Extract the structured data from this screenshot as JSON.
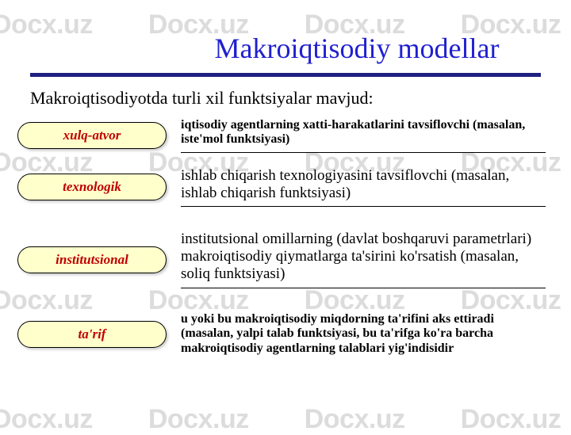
{
  "watermark": "Docx.uz",
  "title": "Makroiqtisodiy modellar",
  "intro": "Makroiqtisodiyotda turli xil funktsiyalar mavjud:",
  "rows": [
    {
      "label": "xulq-atvor",
      "desc": "iqtisodiy agentlarning xatti-harakatlarini tavsiflovchi (masalan, iste'mol funktsiyasi)",
      "styleClass": "small",
      "rule": true
    },
    {
      "label": "texnologik",
      "desc": "ishlab chiqarish texnologiyasini tavsiflovchi (masalan, ishlab chiqarish funktsiyasi)",
      "styleClass": "big",
      "rule": true
    },
    {
      "label": "institutsional",
      "desc": "institutsional omillarning (davlat boshqaruvi parametrlari) makroiqtisodiy qiymatlarga ta'sirini ko'rsatish (masalan, soliq funktsiyasi)",
      "styleClass": "big",
      "rule": true
    },
    {
      "label": "ta'rif",
      "desc": "u yoki bu makroiqtisodiy miqdorning ta'rifini aks ettiradi (masalan, yalpi talab funktsiyasi, bu ta'rifga ko'ra barcha makroiqtisodiy agentlarning talablari yig'indisidir",
      "styleClass": "small",
      "rule": false
    }
  ]
}
